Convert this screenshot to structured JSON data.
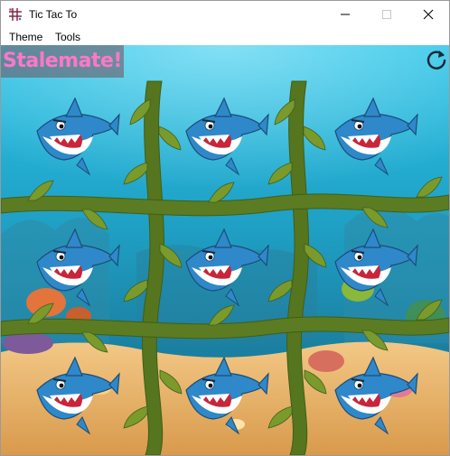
{
  "window": {
    "title": "Tic Tac To",
    "icon": "tic-tac-toe-app-icon",
    "controls": [
      "minimize",
      "maximize",
      "close"
    ]
  },
  "menu": {
    "theme": "Theme",
    "tools": "Tools"
  },
  "game": {
    "status": "Stalemate!",
    "restart_icon": "restart-icon",
    "board": [
      [
        "shark",
        "shark",
        "shark"
      ],
      [
        "shark",
        "shark",
        "shark"
      ],
      [
        "shark",
        "shark",
        "shark"
      ]
    ],
    "colors": {
      "status_text": "#ff77c8",
      "water_top": "#1fb6d8",
      "sand": "#e5b36d",
      "seaweed": "#4f6a1c"
    }
  }
}
